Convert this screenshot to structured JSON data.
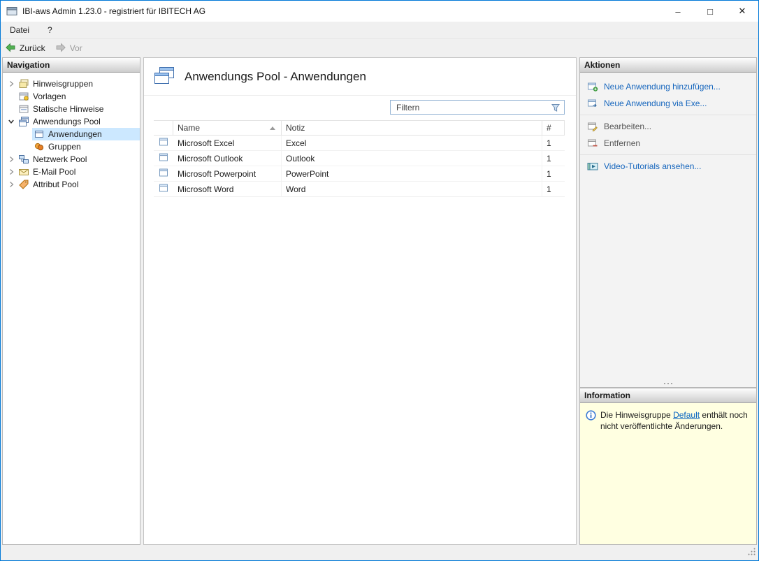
{
  "window": {
    "title": "IBI-aws Admin 1.23.0 - registriert für IBITECH AG"
  },
  "menu": {
    "items": [
      {
        "label": "Datei"
      },
      {
        "label": "?"
      }
    ]
  },
  "toolbar": {
    "back": "Zurück",
    "forward": "Vor"
  },
  "navigation": {
    "header": "Navigation",
    "items": [
      {
        "label": "Hinweisgruppen",
        "state": "collapsed"
      },
      {
        "label": "Vorlagen",
        "state": "leaf"
      },
      {
        "label": "Statische Hinweise",
        "state": "leaf"
      },
      {
        "label": "Anwendungs Pool",
        "state": "expanded"
      },
      {
        "label": "Anwendungen",
        "state": "leaf-selected"
      },
      {
        "label": "Gruppen",
        "state": "leaf"
      },
      {
        "label": "Netzwerk Pool",
        "state": "collapsed"
      },
      {
        "label": "E-Mail Pool",
        "state": "collapsed"
      },
      {
        "label": "Attribut Pool",
        "state": "collapsed"
      }
    ]
  },
  "main": {
    "title": "Anwendungs Pool - Anwendungen",
    "filter": {
      "placeholder": "Filtern"
    },
    "table": {
      "columns": {
        "name": "Name",
        "notiz": "Notiz",
        "count": "#"
      },
      "sort": {
        "column": "Name",
        "direction": "ascending"
      },
      "rows": [
        {
          "name": "Microsoft Excel",
          "notiz": "Excel",
          "count": "1"
        },
        {
          "name": "Microsoft Outlook",
          "notiz": "Outlook",
          "count": "1"
        },
        {
          "name": "Microsoft Powerpoint",
          "notiz": "PowerPoint",
          "count": "1"
        },
        {
          "name": "Microsoft Word",
          "notiz": "Word",
          "count": "1"
        }
      ]
    }
  },
  "actions": {
    "header": "Aktionen",
    "items": [
      {
        "label": "Neue Anwendung hinzufügen...",
        "style": "link"
      },
      {
        "label": "Neue Anwendung via Exe...",
        "style": "link"
      },
      {
        "label": "Bearbeiten...",
        "style": "plain"
      },
      {
        "label": "Entfernen",
        "style": "plain"
      },
      {
        "label": "Video-Tutorials ansehen...",
        "style": "link"
      }
    ]
  },
  "information": {
    "header": "Information",
    "text_before": "Die Hinweisgruppe ",
    "link": "Default",
    "text_after": " enthält noch nicht veröffentlichte Änderungen."
  }
}
